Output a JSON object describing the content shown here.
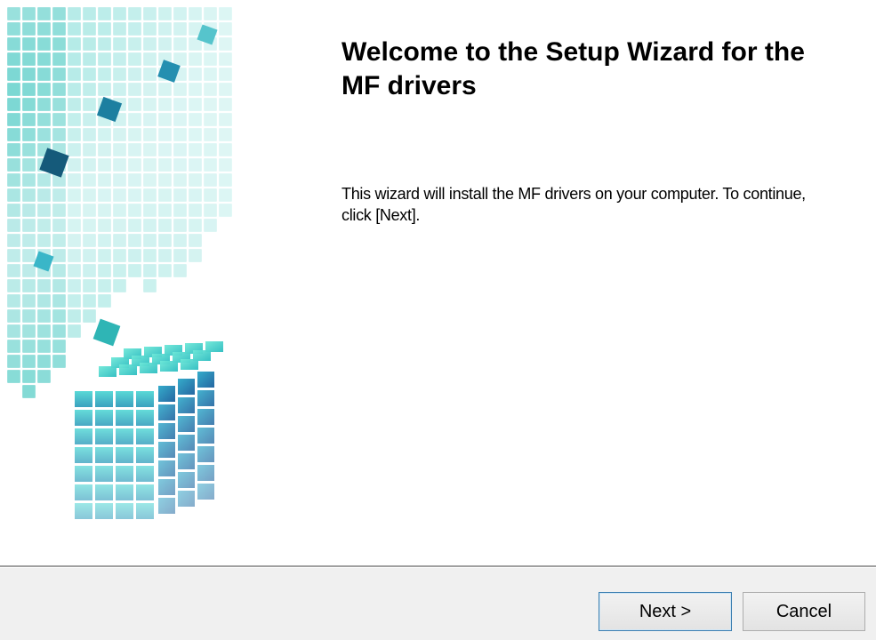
{
  "wizard": {
    "title": "Welcome to the Setup Wizard for the MF drivers",
    "description": "This wizard will install the MF drivers on your computer. To continue, click [Next].",
    "banner_icon": "cube-blocks-graphic"
  },
  "buttons": {
    "next_label": "Next >",
    "cancel_label": "Cancel"
  },
  "colors": {
    "accent_teal": "#2ec4c4",
    "accent_blue": "#1e6fb0",
    "footer_bg": "#f0f0f0"
  }
}
